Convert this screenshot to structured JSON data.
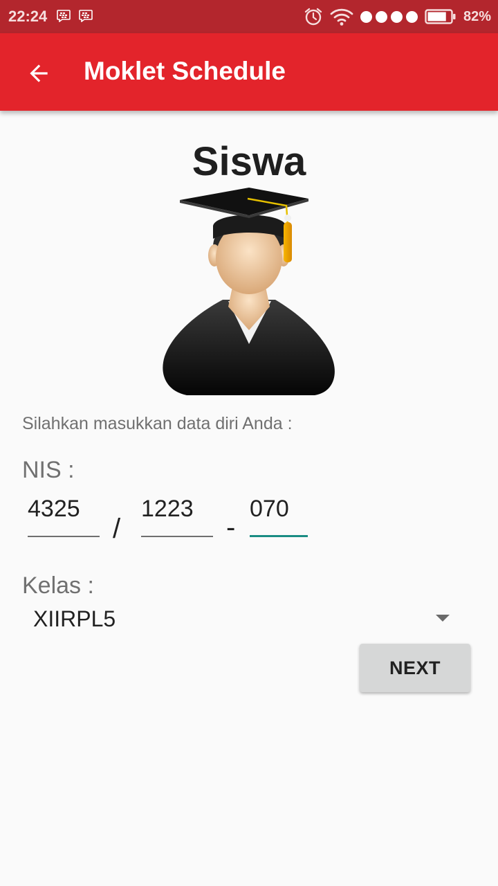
{
  "status_bar": {
    "time": "22:24",
    "battery_percent": "82%",
    "battery_level": 0.82,
    "signal_dots": 4,
    "icons": [
      "bbm-icon",
      "bbm-icon",
      "alarm-icon",
      "wifi-icon",
      "signal-dots-icon",
      "battery-icon"
    ]
  },
  "app_bar": {
    "title": "Moklet Schedule",
    "back_icon": "arrow-left-icon",
    "color": "#e3242b"
  },
  "main": {
    "heading": "Siswa",
    "avatar_icon": "graduate-student-icon",
    "instruction": "Silahkan masukkan data diri Anda :",
    "nis_label": "NIS :",
    "nis_fields": [
      {
        "value": "4325"
      },
      {
        "value": "1223"
      },
      {
        "value": "070",
        "focused": true
      }
    ],
    "nis_separators": [
      "/",
      "-"
    ],
    "kelas_label": "Kelas :",
    "kelas_selected": "XIIRPL5",
    "next_label": "NEXT"
  },
  "colors": {
    "status_bar": "#b3262d",
    "app_bar": "#e3242b",
    "focus_underline": "#1a8c83",
    "button": "#d6d7d7"
  }
}
